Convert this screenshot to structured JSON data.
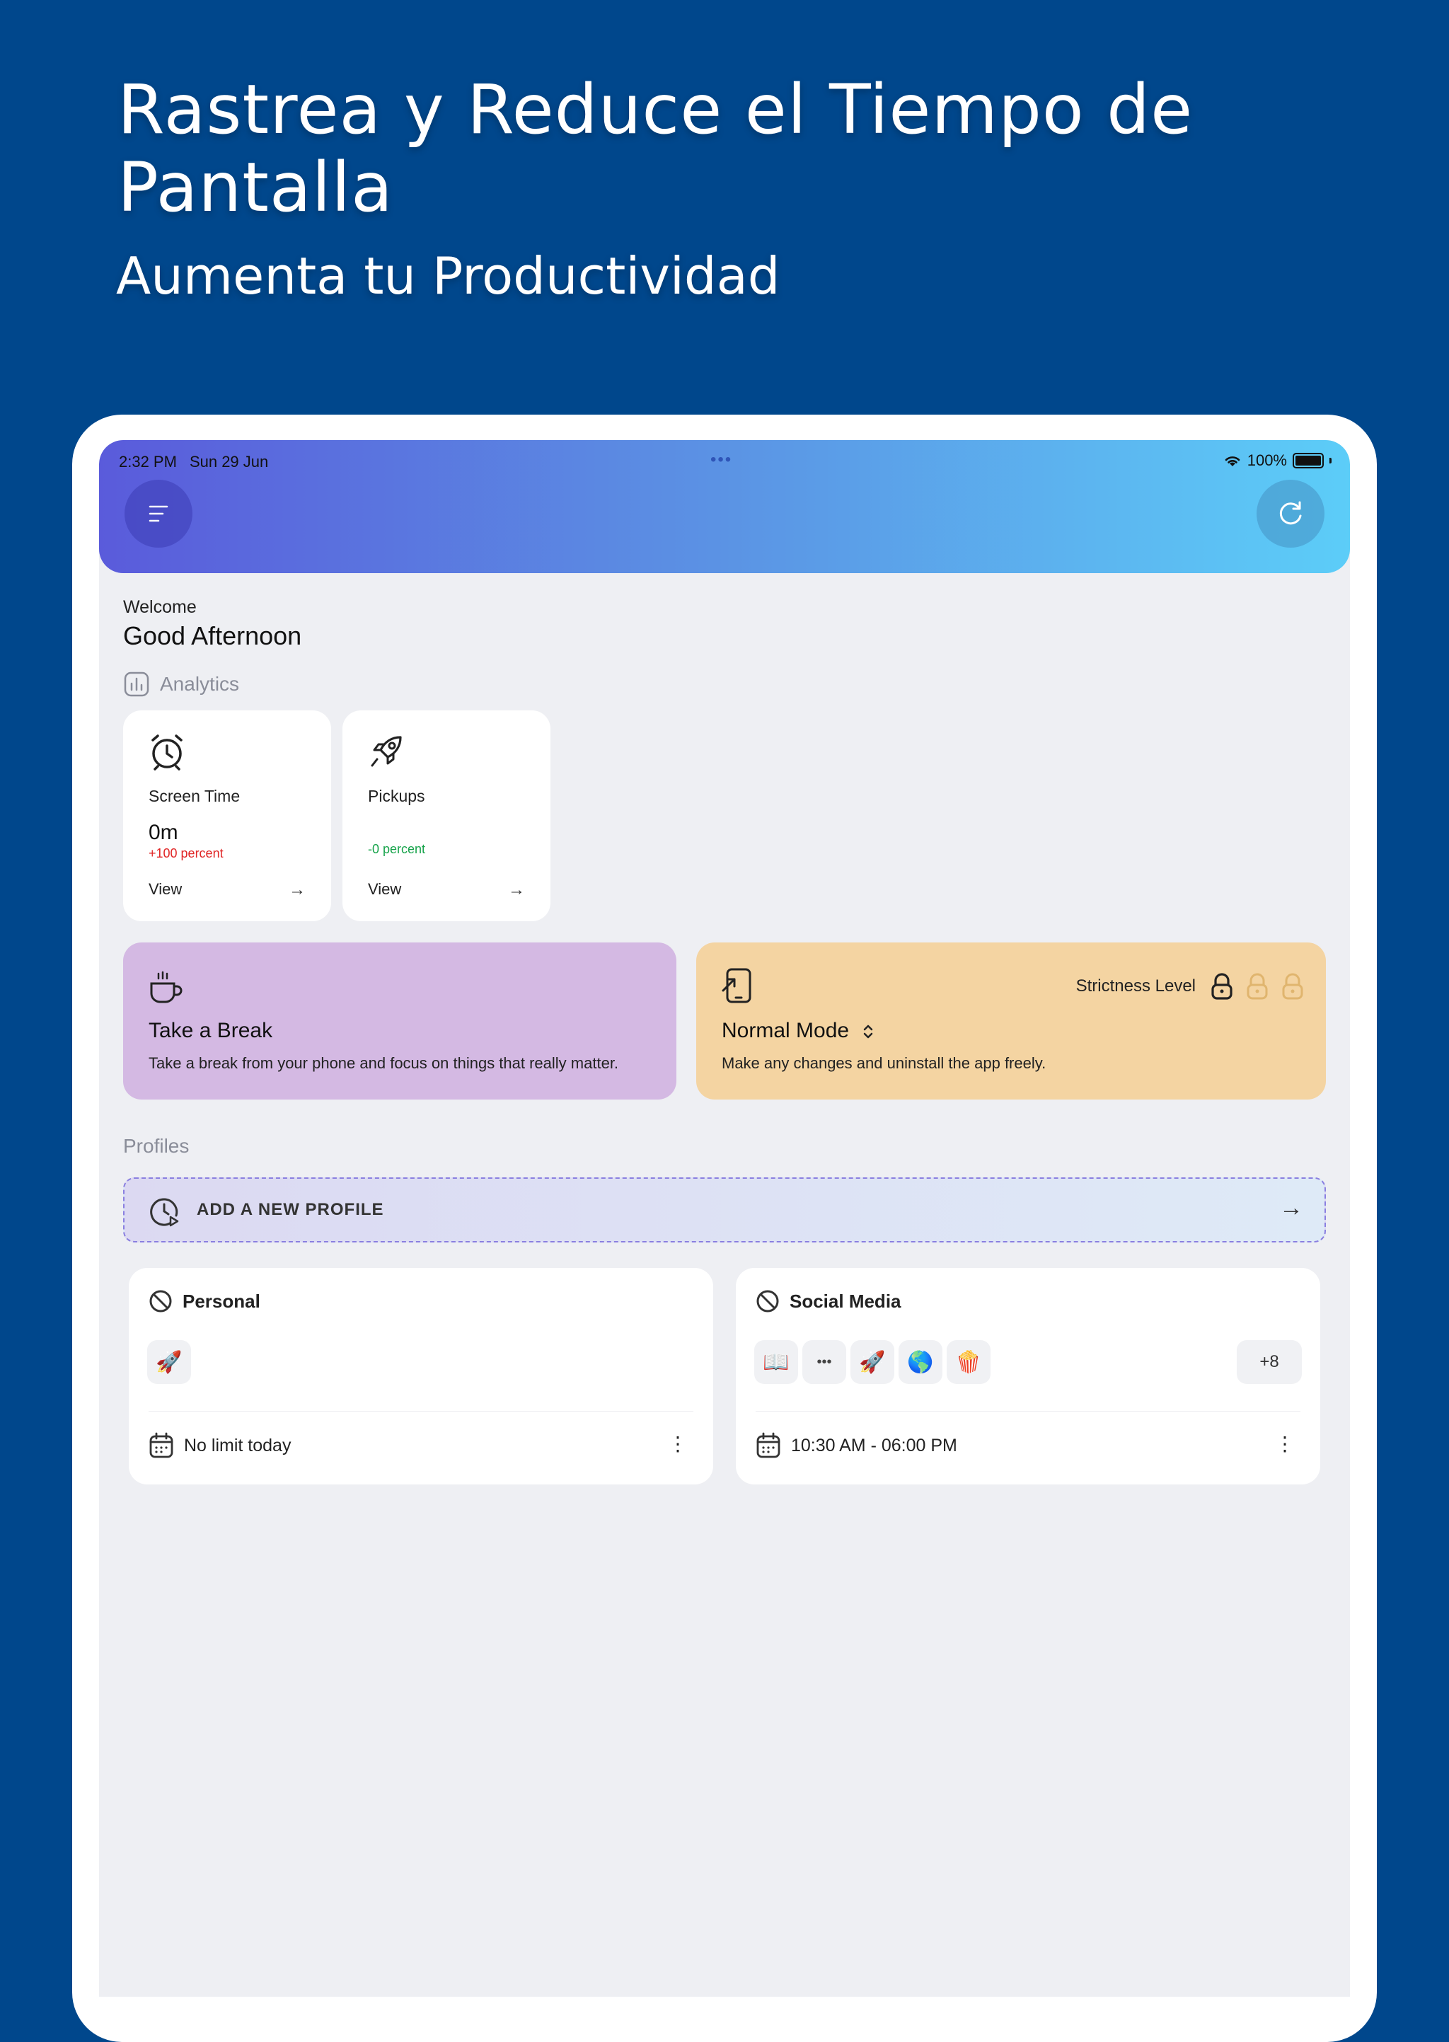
{
  "promo": {
    "title": "Rastrea y Reduce el Tiempo de Pantalla",
    "subtitle": "Aumenta tu Productividad"
  },
  "status_bar": {
    "time": "2:32 PM",
    "date": "Sun 29 Jun",
    "battery": "100%"
  },
  "header": {
    "welcome": "Welcome",
    "greeting": "Good Afternoon"
  },
  "analytics": {
    "title": "Analytics",
    "cards": [
      {
        "label": "Screen Time",
        "value": "0m",
        "delta": "+100 percent",
        "delta_color": "#E02424",
        "view": "View",
        "icon": "stopwatch-icon"
      },
      {
        "label": "Pickups",
        "value": "",
        "delta": "-0 percent",
        "delta_color": "#16A34A",
        "view": "View",
        "icon": "rocket-icon"
      }
    ]
  },
  "break_card": {
    "title": "Take a Break",
    "description": "Take a break from your phone and focus on things that really matter.",
    "icon": "coffee-icon",
    "color": "#D4B9E3"
  },
  "mode_card": {
    "title": "Normal Mode",
    "description": "Make any changes and uninstall the app freely.",
    "strictness_label": "Strictness Level",
    "strictness_level": 1,
    "strictness_max": 3,
    "icon": "phone-tap-icon",
    "color": "#F4D4A2"
  },
  "profiles": {
    "title": "Profiles",
    "add_label": "ADD A NEW PROFILE",
    "items": [
      {
        "name": "Personal",
        "apps": [
          "🚀"
        ],
        "extra": "",
        "schedule": "No limit today"
      },
      {
        "name": "Social Media",
        "apps": [
          "📖",
          "•••",
          "🚀",
          "🌎",
          "🍿"
        ],
        "extra": "+8",
        "schedule": "10:30 AM - 06:00 PM"
      }
    ]
  },
  "colors": {
    "background": "#00478C",
    "header_gradient_start": "#5A5BDB",
    "header_gradient_end": "#5CCDF8",
    "screen_bg": "#EEEFF3"
  }
}
